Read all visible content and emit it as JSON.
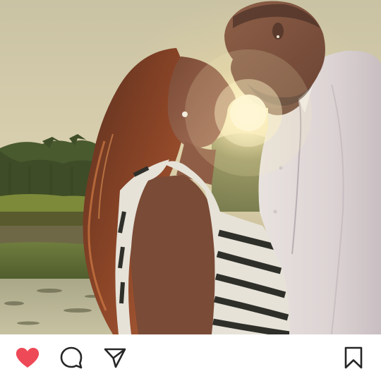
{
  "post": {
    "image": {
      "subject": "couple-kissing-at-sunset",
      "scene": "sunset-field-with-palm-trees"
    },
    "actions": {
      "like": {
        "icon": "heart-icon",
        "state": "liked",
        "color": "#ed4956"
      },
      "comment": {
        "icon": "speech-bubble-icon"
      },
      "share": {
        "icon": "paper-plane-icon"
      },
      "save": {
        "icon": "bookmark-icon"
      }
    },
    "colors": {
      "like_active": "#ed4956",
      "icon_stroke": "#262626",
      "background": "#ffffff"
    }
  }
}
